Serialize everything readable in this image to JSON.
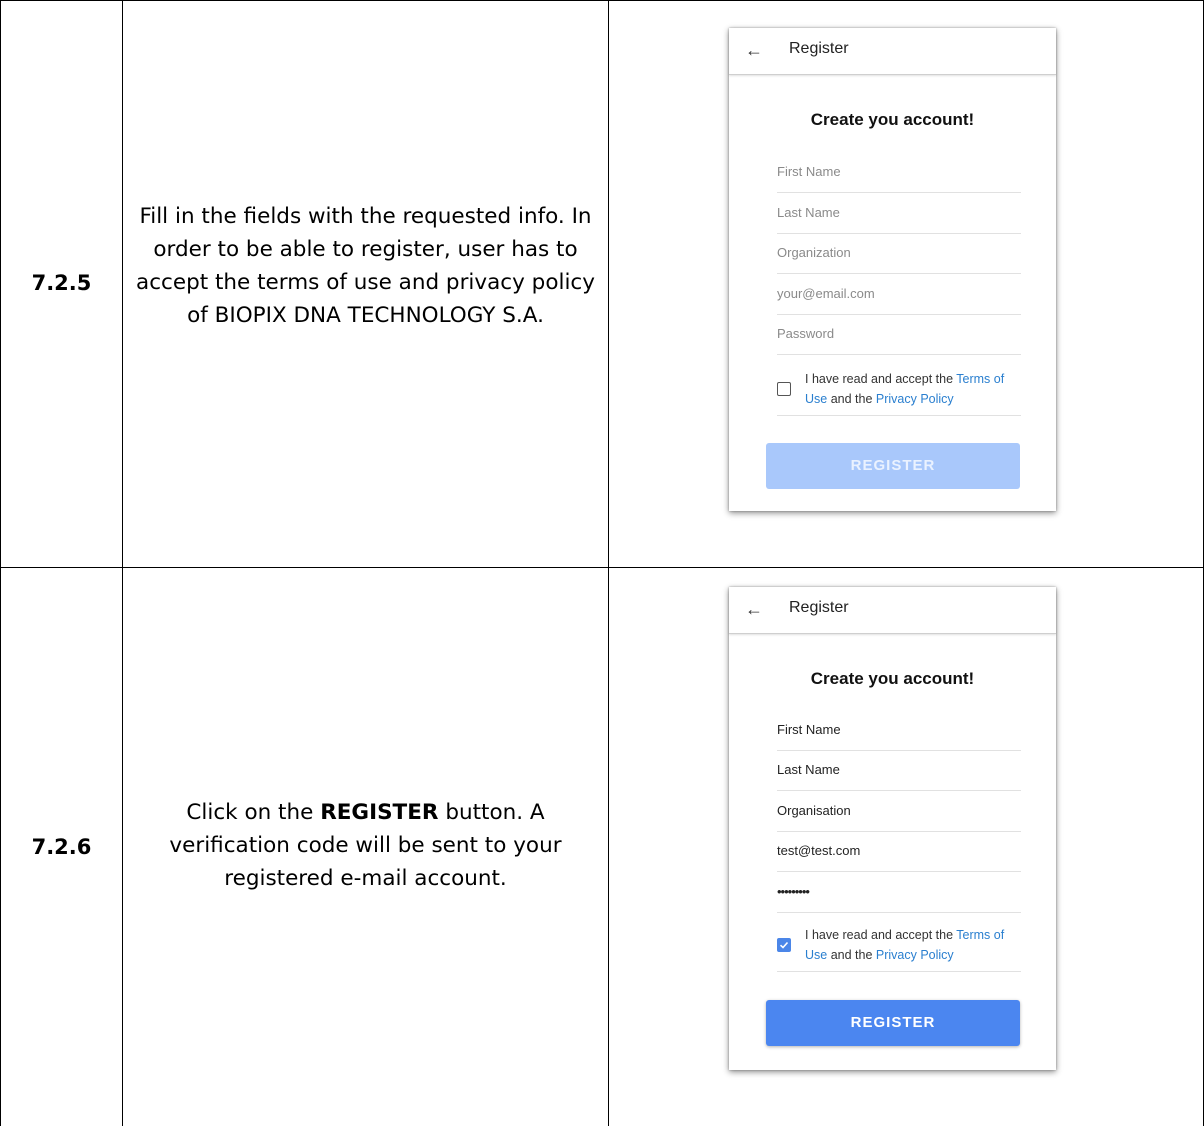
{
  "rows": [
    {
      "step": "7.2.5",
      "description": "Fill in the fields with the requested info. In order to be able to register, user has to accept the terms of use and privacy policy of BIOPIX DNA TECHNOLOGY S.A.",
      "screen": {
        "back_icon": "arrow-left-icon",
        "title": "Register",
        "form_title": "Create you account!",
        "fields": [
          {
            "value": "",
            "placeholder": "First Name"
          },
          {
            "value": "",
            "placeholder": "Last Name"
          },
          {
            "value": "",
            "placeholder": "Organization"
          },
          {
            "value": "",
            "placeholder": "your@email.com"
          },
          {
            "value": "",
            "placeholder": "Password"
          }
        ],
        "terms_checked": false,
        "terms_prefix": "I have read and accept the ",
        "terms_link": "Terms of Use",
        "terms_middle": " and the ",
        "privacy_link": "Privacy Policy",
        "button": "REGISTER",
        "button_enabled": false
      }
    },
    {
      "step": "7.2.6",
      "description_prefix": "Click on the ",
      "description_bold": "REGISTER",
      "description_suffix": " button. A verification code will be sent to your registered e-mail account.",
      "screen": {
        "back_icon": "arrow-left-icon",
        "title": "Register",
        "form_title": "Create you account!",
        "fields": [
          {
            "value": "First Name"
          },
          {
            "value": "Last Name"
          },
          {
            "value": "Organisation"
          },
          {
            "value": "test@test.com"
          },
          {
            "value": "•••••••••"
          }
        ],
        "terms_checked": true,
        "terms_prefix": "I have read and accept the ",
        "terms_link": "Terms of Use",
        "terms_middle": " and the ",
        "privacy_link": "Privacy Policy",
        "button": "REGISTER",
        "button_enabled": true
      }
    }
  ],
  "colors": {
    "link": "#2a7fcf",
    "button_enabled": "#4b86f0",
    "button_disabled": "#a9c8fb",
    "checkbox_checked": "#4b86e8"
  }
}
